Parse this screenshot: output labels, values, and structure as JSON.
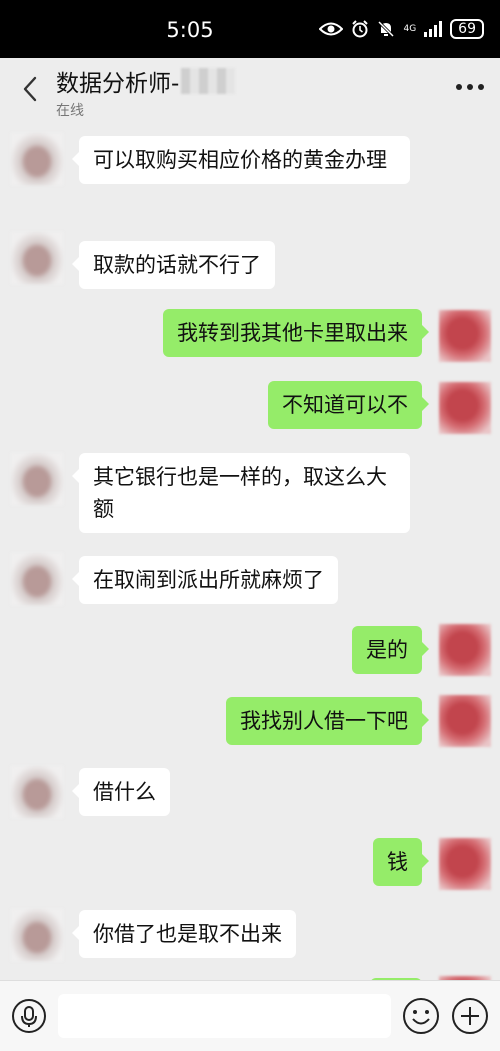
{
  "status_bar": {
    "time": "5:05",
    "network": "4G",
    "battery": "69"
  },
  "header": {
    "title": "数据分析师-",
    "subtitle": "在线"
  },
  "messages": [
    {
      "side": "left",
      "text": "可以取购买相应价格的黄金办理"
    },
    {
      "side": "left",
      "text": "取款的话就不行了"
    },
    {
      "side": "right",
      "text": "我转到我其他卡里取出来"
    },
    {
      "side": "right",
      "text": "不知道可以不"
    },
    {
      "side": "left",
      "text": "其它银行也是一样的，取这么大额"
    },
    {
      "side": "left",
      "text": "在取闹到派出所就麻烦了"
    },
    {
      "side": "right",
      "text": "是的"
    },
    {
      "side": "right",
      "text": "我找别人借一下吧"
    },
    {
      "side": "left",
      "text": "借什么"
    },
    {
      "side": "right",
      "text": "钱"
    },
    {
      "side": "left",
      "text": "你借了也是取不出来"
    }
  ],
  "colors": {
    "background": "#ededed",
    "sent_bubble": "#95ec69",
    "received_bubble": "#ffffff"
  },
  "icons": [
    "eye-icon",
    "alarm-icon",
    "mute-icon",
    "signal-icon",
    "battery-icon",
    "back-chevron-icon",
    "more-icon",
    "voice-icon",
    "emoji-icon",
    "plus-icon"
  ]
}
